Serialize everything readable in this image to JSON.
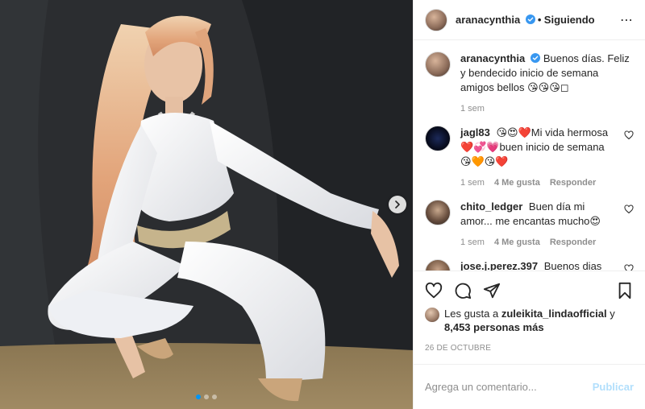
{
  "header": {
    "username": "aranacynthia",
    "separator": "•",
    "follow_label": "Siguiendo",
    "more_label": "⋯"
  },
  "caption": {
    "username": "aranacynthia",
    "text": "Buenos días. Feliz y bendecido inicio de semana amigos bellos 😘😘😘◻",
    "time": "1 sem"
  },
  "comments": [
    {
      "username": "jagl83",
      "text": "😘😍❤️Mi vida hermosa ❤️💞💗buen inicio de semana 😘🧡😘❤️",
      "time": "1 sem",
      "likes": "4 Me gusta",
      "reply": "Responder"
    },
    {
      "username": "chito_ledger",
      "text": "Buen día mi amor... me encantas mucho😍",
      "time": "1 sem",
      "likes": "4 Me gusta",
      "reply": "Responder"
    },
    {
      "username": "jose.j.perez.397",
      "text": "Buenos dias😍❤️"
    }
  ],
  "likes": {
    "prefix": "Les gusta a",
    "first_user": "zuleikita_lindaofficial",
    "joiner": "y",
    "others": "8,453 personas más"
  },
  "date": "26 DE OCTUBRE",
  "add_comment": {
    "placeholder": "Agrega un comentario...",
    "publish_label": "Publicar"
  },
  "carousel": {
    "count": 3,
    "active_index": 0
  },
  "colors": {
    "verified": "#3897f0",
    "link_disabled": "#b2dffc",
    "muted": "#8e8e8e",
    "active_dot": "#0095f6"
  }
}
